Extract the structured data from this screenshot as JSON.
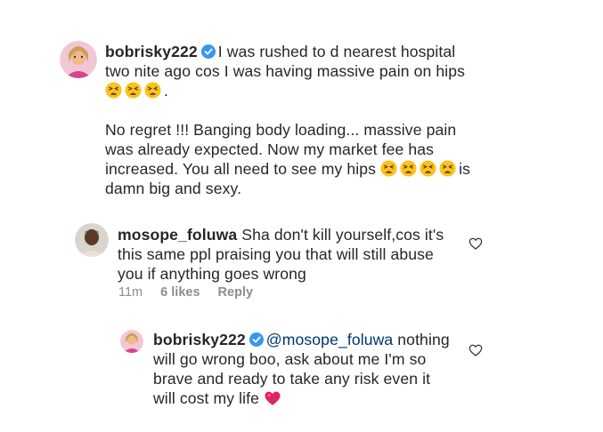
{
  "post": {
    "username": "bobrisky222",
    "line1": "I was rushed to d nearest hospital",
    "line2": "two nite ago cos I was having massive pain on hips",
    "line3_end": ".",
    "para2_line1": "No regret !!! Banging body loading... massive pain",
    "para2_line2": "was already expected. Now my market fee has",
    "para2_line3": "increased. You all need to see my hips",
    "para2_line3_end": "is",
    "para2_line4": "damn big and sexy.",
    "emoji_icon": "tired-face-emoji"
  },
  "comment": {
    "username": "mosope_foluwa",
    "line1": "Sha don't kill yourself,cos it's",
    "line2": "this same ppl praising you that will still abuse",
    "line3": "you if anything goes wrong",
    "time": "11m",
    "likes": "6 likes",
    "reply": "Reply"
  },
  "reply": {
    "username": "bobrisky222",
    "mention": "@mosope_foluwa",
    "line1_end": "nothing",
    "line2": "will go wrong boo, ask about me I'm so",
    "line3": "brave and ready to take any risk even it",
    "line4": "will cost my life",
    "heart_icon": "red-heart-emoji"
  },
  "colors": {
    "text": "#262626",
    "meta": "#8e8e8e",
    "verified": "#3897f0",
    "mention": "#00376b",
    "heart": "#e0245e"
  }
}
